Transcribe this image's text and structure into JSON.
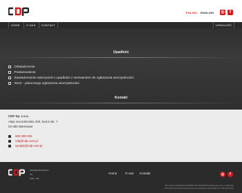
{
  "header": {
    "logo_alt": "cdp",
    "lang_pl": "POLSKI",
    "lang_en": "ENGLISH",
    "instagram_glyph": "◎",
    "facebook_glyph": "f"
  },
  "nav": {
    "home": "HOME",
    "onas": "O NAS",
    "kontakt": "KONTAKT",
    "right": "UPADŁOŚĆ"
  },
  "hero": {
    "title": "Upadłość",
    "documents": [
      {
        "label": "Oświadczenie"
      },
      {
        "label": "Postanowienie"
      },
      {
        "label": "Zawiadomienie wierzycieli o upadłości z wezwaniem do zgłaszania wierzytelności"
      },
      {
        "label": "Wzór - pisemnego zgłoszenia wierzytelności"
      }
    ],
    "contact_title": "Kontakt"
  },
  "contact": {
    "company": "CDP Sp. z o.o.",
    "address1": "Aleje Jerozolimskie 200, bud.5 lok. 7",
    "address2": "02-486 Warszawa",
    "phone": "600 300 033",
    "email1": "cdp@cdp.com.pl",
    "email2": "syndyk@cdp.com.pl"
  },
  "footer": {
    "small1": "CDP@CDP.COM.PL",
    "small2": "Tel.",
    "small3": "Faks: +48",
    "nav_home": "Home",
    "nav_onas": "O nas",
    "nav_kontakt": "Kontakt",
    "legal1": "NIP: 00-00-00-000 REGON: 000000000 KRS 0000000000 Sąd Rejonowy dla m.st. Warszawy",
    "legal2": "XII Wydział Gospodarczy Krajowego Rejestru Sądowego, kapitał zakładowy: 0 000 000,00 PLN"
  },
  "colors": {
    "accent": "#d01c1c",
    "nav_bg": "#2a2a2a",
    "hero_bg": "#333333",
    "footer_bg": "#2b2b2b"
  }
}
